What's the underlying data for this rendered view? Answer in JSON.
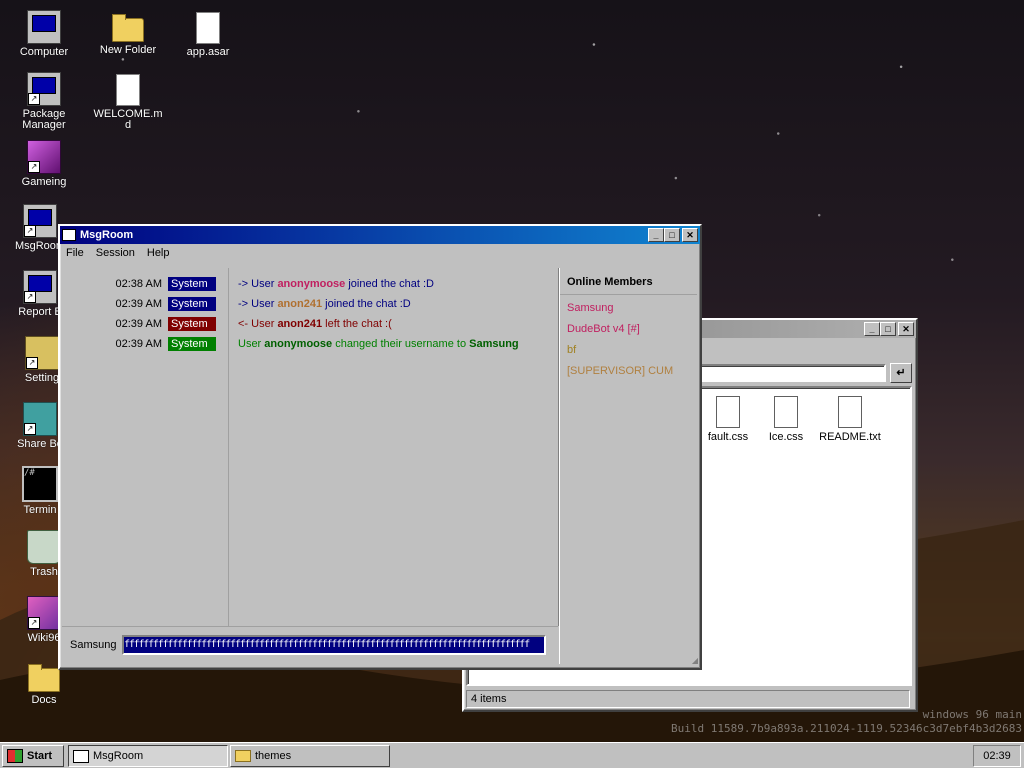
{
  "desktop": {
    "icons": [
      {
        "label": "Computer"
      },
      {
        "label": "New Folder"
      },
      {
        "label": "app.asar"
      },
      {
        "label": "Package Manager"
      },
      {
        "label": "WELCOME.md"
      },
      {
        "label": "Gameing"
      },
      {
        "label": "MsgRoom"
      },
      {
        "label": "Report B"
      },
      {
        "label": "Setting"
      },
      {
        "label": "Share Bo"
      },
      {
        "label": "Termin"
      },
      {
        "label": "Trash"
      },
      {
        "label": "Wiki96"
      },
      {
        "label": "Docs"
      }
    ],
    "watermark": {
      "line1": "windows 96 main",
      "line2": "Build 11589.7b9a893a.211024-1119.52346c3d7ebf4b3d2683"
    }
  },
  "explorer": {
    "title": "themes",
    "address": "",
    "files": [
      {
        "name": "fault.css"
      },
      {
        "name": "Ice.css"
      },
      {
        "name": "README.txt"
      }
    ],
    "status": "4 items"
  },
  "msgroom": {
    "title": "MsgRoom",
    "menu": {
      "file": "File",
      "session": "Session",
      "help": "Help"
    },
    "messages": [
      {
        "time": "02:38 AM",
        "source": "System",
        "source_color": "#000080",
        "prefix": "-> User ",
        "user": "anonymoose",
        "user_color": "#c02060",
        "suffix": " joined the chat :D",
        "suffix2": "",
        "text_color": "#000080"
      },
      {
        "time": "02:39 AM",
        "source": "System",
        "source_color": "#000080",
        "prefix": "-> User ",
        "user": "anon241",
        "user_color": "#b07030",
        "suffix": " joined the chat :D",
        "suffix2": "",
        "text_color": "#000080"
      },
      {
        "time": "02:39 AM",
        "source": "System",
        "source_color": "#800000",
        "prefix": "<- User ",
        "user": "anon241",
        "user_color": "#800000",
        "suffix": " left the chat :(",
        "suffix2": "",
        "text_color": "#800000"
      },
      {
        "time": "02:39 AM",
        "source": "System",
        "source_color": "#008000",
        "prefix": "User ",
        "user": "anonymoose",
        "user_color": "#006000",
        "suffix": " changed their username to ",
        "suffix2": "Samsung",
        "text_color": "#008000"
      }
    ],
    "members_heading": "Online Members",
    "members": [
      {
        "name": "Samsung",
        "color": "#c02060"
      },
      {
        "name": "DudeBot v4 [#]",
        "color": "#c02060"
      },
      {
        "name": "bf",
        "color": "#a08020"
      },
      {
        "name": "[SUPERVISOR] CUM",
        "color": "#b08040"
      }
    ],
    "composer": {
      "username": "Samsung",
      "value": "ffffffffffffffffffffffffffffffffffffffffffffffffffffffffffffffffffffffffffffffffffff"
    }
  },
  "taskbar": {
    "start": "Start",
    "tasks": [
      {
        "label": "MsgRoom"
      },
      {
        "label": "themes"
      }
    ],
    "clock": "02:39"
  }
}
